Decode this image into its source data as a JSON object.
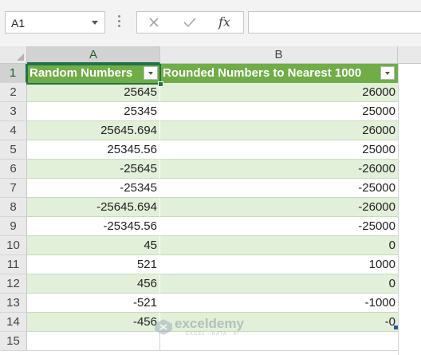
{
  "name_box": {
    "value": "A1"
  },
  "formula_bar": {
    "fx_label": "fx",
    "value": ""
  },
  "columns": [
    "A",
    "B"
  ],
  "row_numbers": [
    "1",
    "2",
    "3",
    "4",
    "5",
    "6",
    "7",
    "8",
    "9",
    "10",
    "11",
    "12",
    "13",
    "14",
    "15"
  ],
  "table": {
    "headers": [
      "Random Numbers",
      "Rounded Numbers to Nearest 1000"
    ],
    "rows": [
      [
        "25645",
        "26000"
      ],
      [
        "25345",
        "25000"
      ],
      [
        "25645.694",
        "26000"
      ],
      [
        "25345.56",
        "25000"
      ],
      [
        "-25645",
        "-26000"
      ],
      [
        "-25345",
        "-25000"
      ],
      [
        "-25645.694",
        "-26000"
      ],
      [
        "-25345.56",
        "-25000"
      ],
      [
        "45",
        "0"
      ],
      [
        "521",
        "1000"
      ],
      [
        "456",
        "0"
      ],
      [
        "-521",
        "-1000"
      ],
      [
        "-456",
        "-0"
      ]
    ]
  },
  "watermark": {
    "name": "exceldemy",
    "tagline": "EXCEL · DATA · BI"
  },
  "colors": {
    "header_fill": "#70ad47",
    "band_fill": "#e2efd9",
    "selection": "#217346"
  }
}
